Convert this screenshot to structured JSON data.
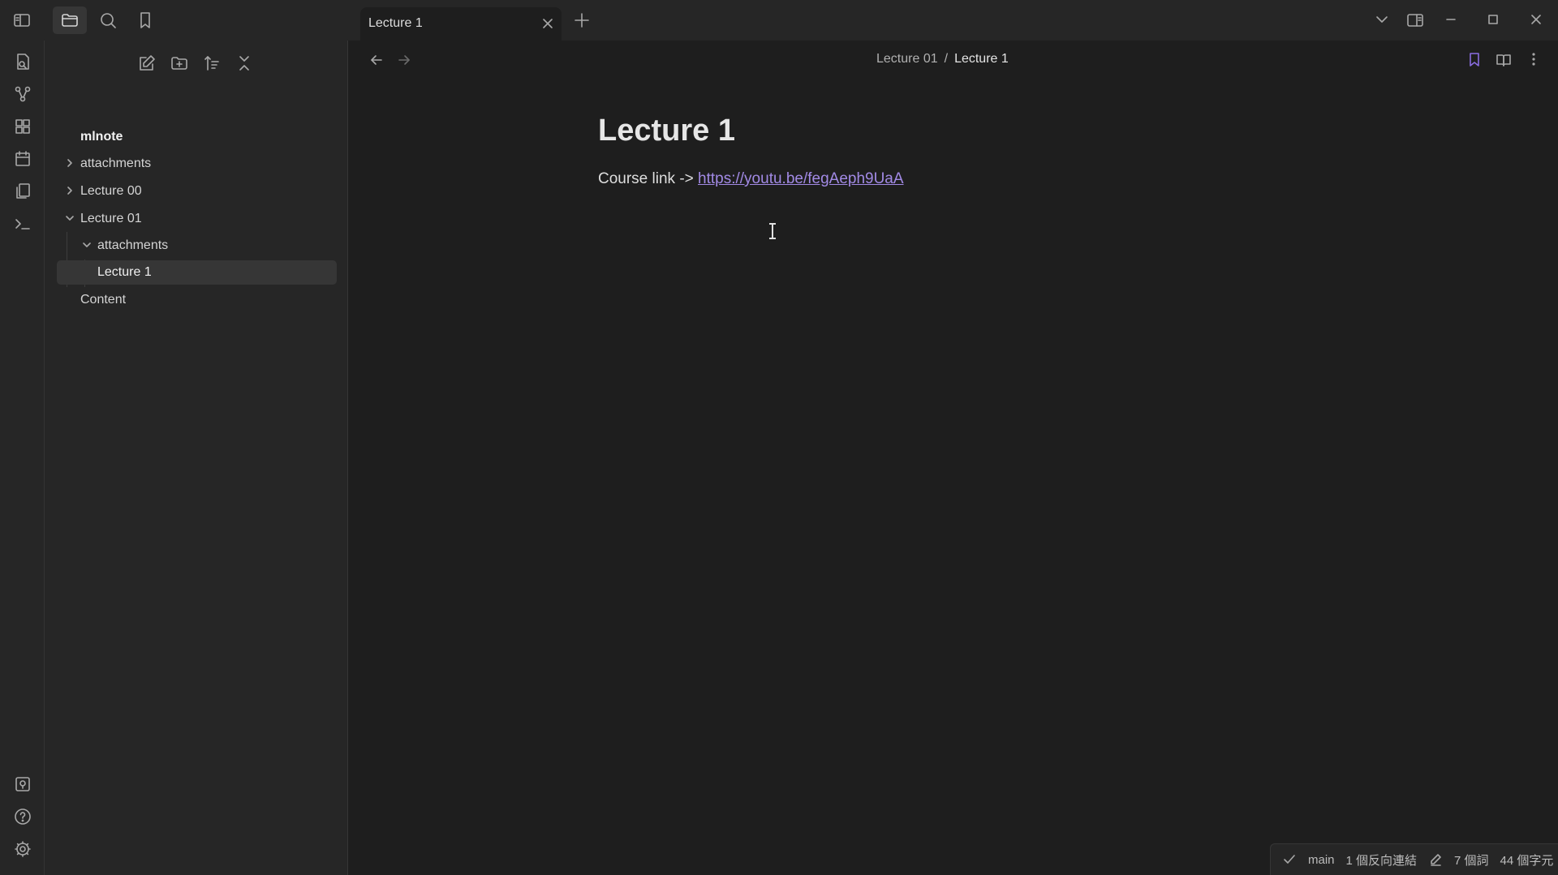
{
  "tab": {
    "title": "Lecture 1"
  },
  "vault": {
    "name": "mlnote"
  },
  "tree": [
    {
      "label": "attachments",
      "type": "folder",
      "expanded": false
    },
    {
      "label": "Lecture 00",
      "type": "folder",
      "expanded": false
    },
    {
      "label": "Lecture 01",
      "type": "folder",
      "expanded": true
    },
    {
      "label": "attachments",
      "type": "folder",
      "expanded": true
    },
    {
      "label": "Lecture 1",
      "type": "file",
      "selected": true
    },
    {
      "label": "Content",
      "type": "file"
    }
  ],
  "breadcrumb": {
    "parent": "Lecture 01",
    "separator": "/",
    "current": "Lecture 1"
  },
  "note": {
    "title": "Lecture 1",
    "prefix": "Course link -> ",
    "link": "https://youtu.be/fegAeph9UaA"
  },
  "status": {
    "branch": "main",
    "backlinks": "1 個反向連結",
    "words": "7 個詞",
    "chars": "44 個字元"
  },
  "colors": {
    "accent": "#a28ae5",
    "bg": "#1e1e1e",
    "panel": "#262626"
  }
}
